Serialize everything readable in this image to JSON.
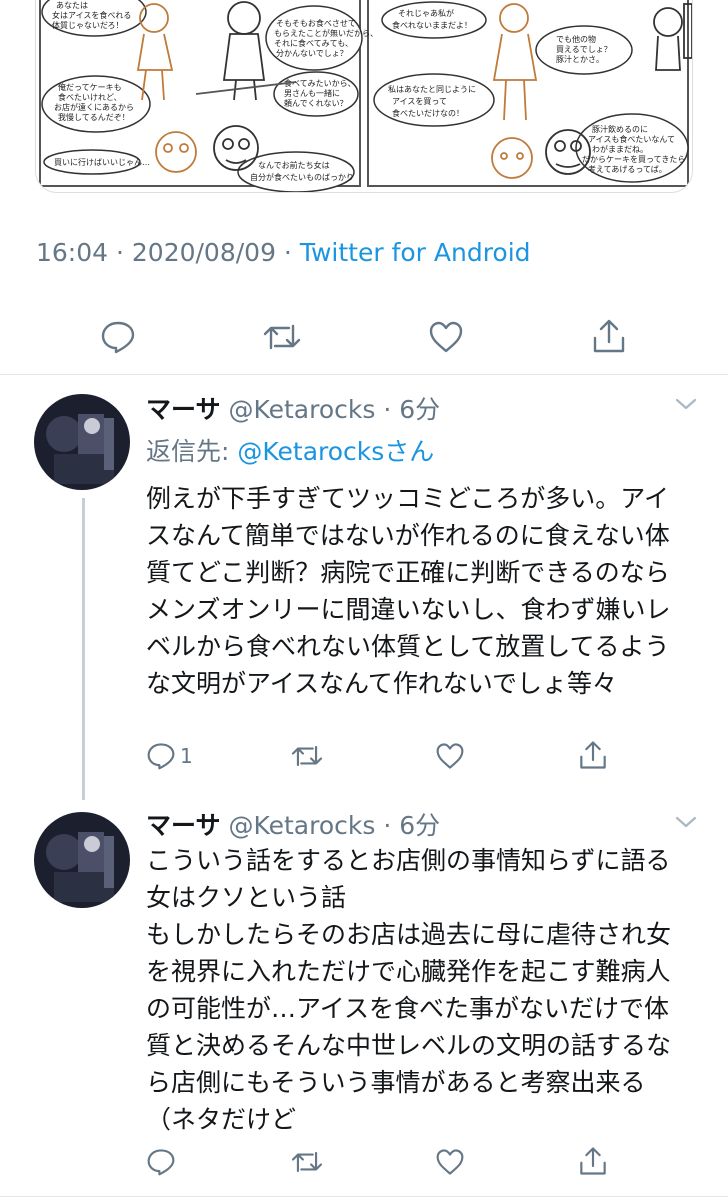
{
  "comic": {
    "left_panel": {
      "bubble_1": [
        "あなたは",
        "女はアイスを食べれる",
        "体質じゃないだろ！"
      ],
      "bubble_2": [
        "そもそもお食べさせて",
        "もらえたことが無いだから、",
        "それに食べてみても、",
        "分かんないでしょ？"
      ],
      "bubble_3": [
        "食べてみたいから、",
        "男さんも一緒に",
        "頼んでくれない？"
      ],
      "bubble_4": [
        "俺だってケーキも",
        "食べたいけれど、",
        "お店が遠くにあるから",
        "我慢してるんだぞ！"
      ],
      "bubble_5": [
        "買いに行けばいいじゃん…"
      ],
      "bubble_6": [
        "なんでお前たち女は",
        "自分が食べたいものばっかり"
      ]
    },
    "right_panel": {
      "bubble_1": [
        "それじゃあ私が",
        "食べれないままだよ！"
      ],
      "bubble_2": [
        "でも他の物",
        "買えるでしょ？",
        "豚汁とかさ。"
      ],
      "bubble_3": [
        "私はあなたと同じように",
        "アイスを買って",
        "食べたいだけなの！"
      ],
      "bubble_4": [
        "豚汁飲めるのに",
        "アイスも食べたいなんて",
        "わがままだね。",
        "だからケーキを買ってきたら",
        "考えてあげるってば。"
      ]
    }
  },
  "tweet_meta": {
    "time": "16:04",
    "separator": " · ",
    "date": "2020/08/09",
    "client": "Twitter for Android"
  },
  "replies": [
    {
      "name": "マーサ",
      "handle": "@Ketarocks",
      "time": "6分",
      "reply_label": "返信先: ",
      "reply_to": "@Ketarocksさん",
      "text": "例えが下手すぎてツッコミどころが多い。アイスなんて簡単ではないが作れるのに食えない体質てどこ判断？病院で正確に判断できるのならメンズオンリーに間違いないし、食わず嫌いレベルから食べれない体質として放置してるような文明がアイスなんて作れないでしょ等々",
      "reply_count": "1"
    },
    {
      "name": "マーサ",
      "handle": "@Ketarocks",
      "time": "6分",
      "text": "こういう話をするとお店側の事情知らずに語る女はクソという話\nもしかしたらそのお店は過去に母に虐待され女を視界に入れただけで心臓発作を起こす難病人の可能性が…アイスを食べた事がないだけで体質と決めるそんな中世レベルの文明の話するなら店側にもそういう事情があると考察出来る（ネタだけど",
      "reply_count": ""
    }
  ],
  "icons": [
    "reply-icon",
    "retweet-icon",
    "like-icon",
    "share-icon",
    "chevron-down-icon"
  ],
  "colors": {
    "link": "#1b95e0",
    "muted": "#657786",
    "text": "#14171a",
    "divider": "#e1e8ed"
  }
}
